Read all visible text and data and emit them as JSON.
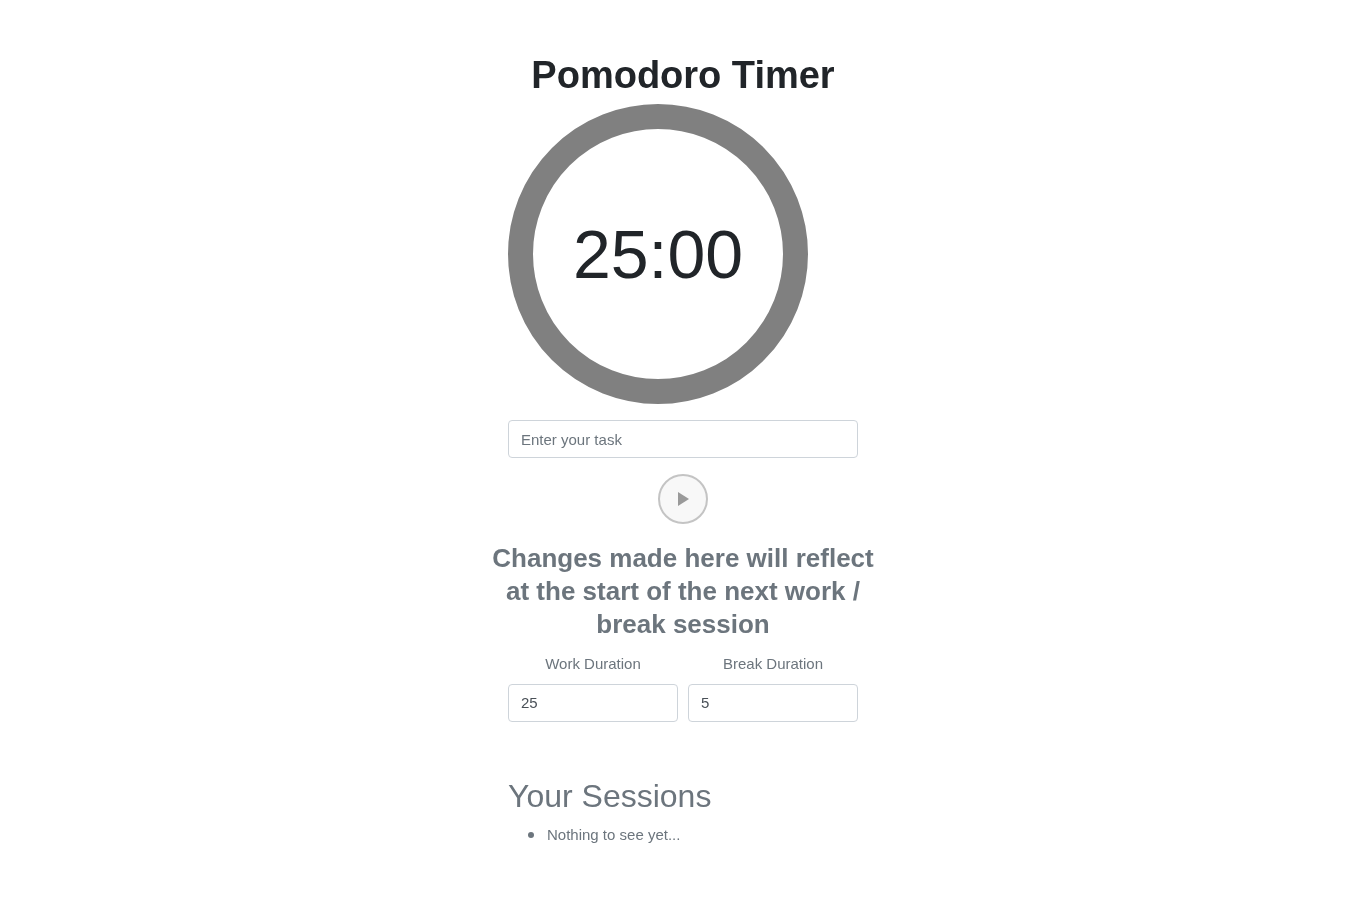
{
  "title": "Pomodoro Timer",
  "timer": {
    "time": "25:00"
  },
  "task": {
    "placeholder": "Enter your task"
  },
  "notice": "Changes made here will reflect at the start of the next work / break session",
  "durations": [
    {
      "label": "Work Duration",
      "value": "25"
    },
    {
      "label": "Break Duration",
      "value": "5"
    }
  ],
  "sessions": {
    "heading": "Your Sessions",
    "items": [
      "Nothing to see yet..."
    ]
  }
}
